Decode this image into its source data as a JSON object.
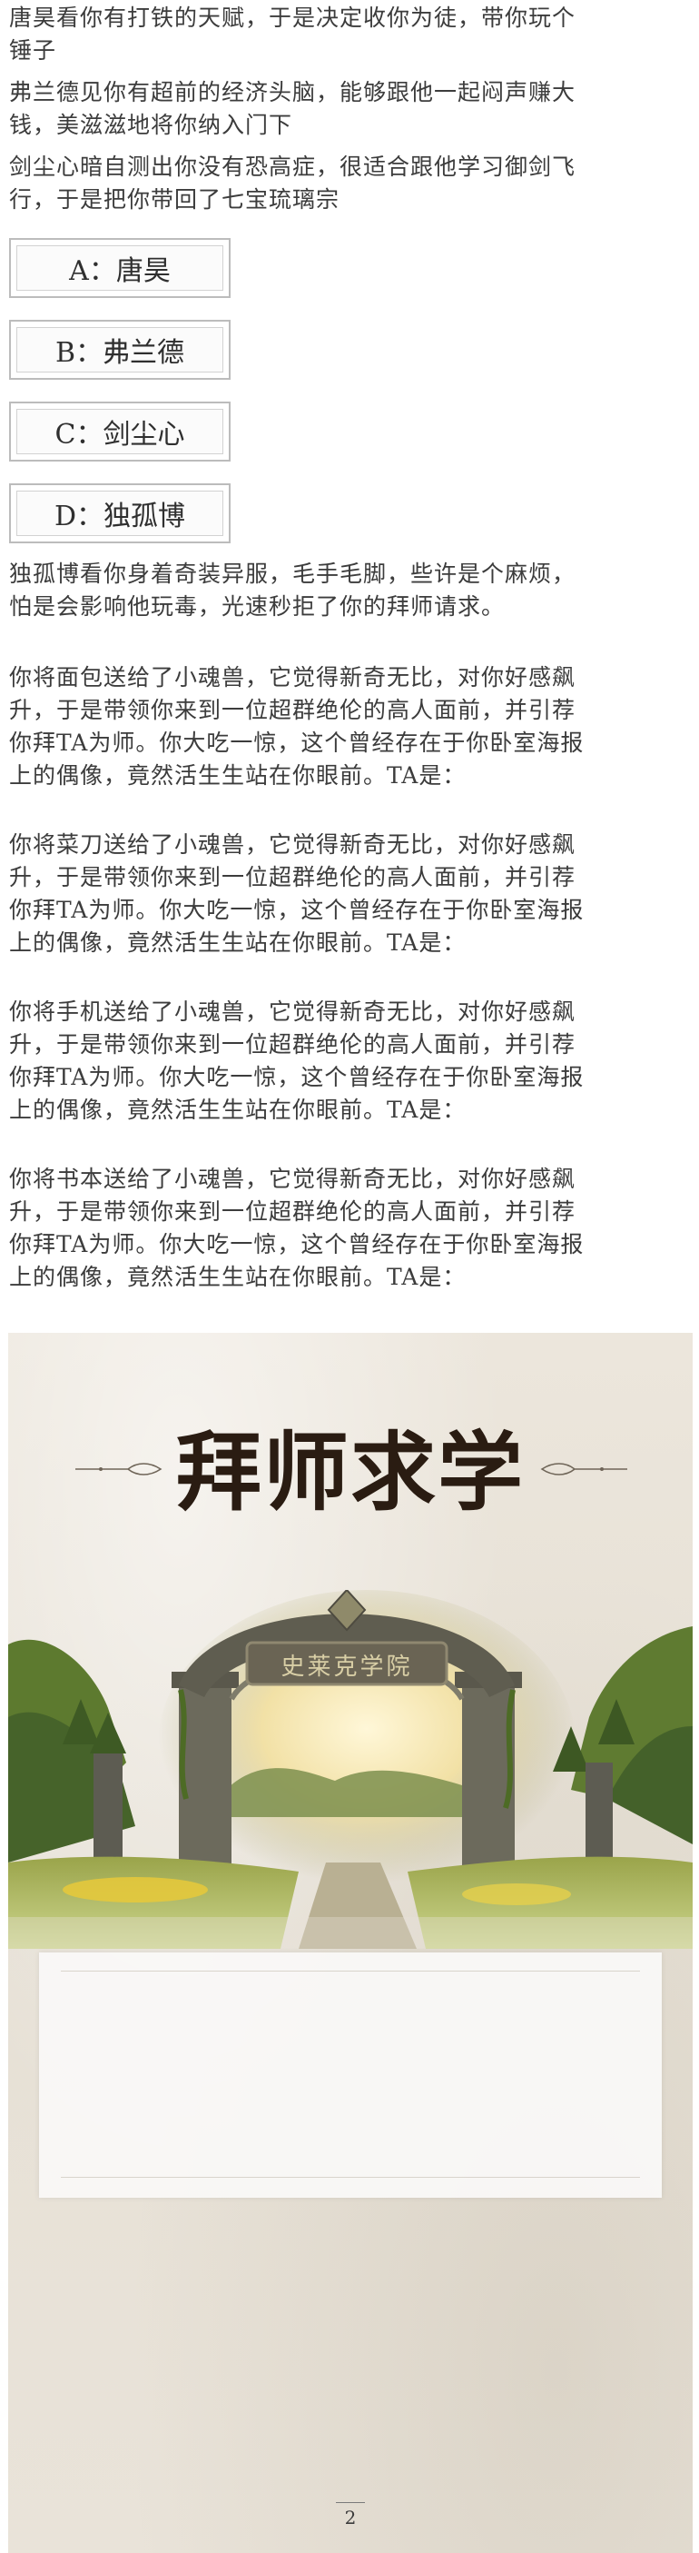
{
  "intro_paragraphs": [
    "唐昊看你有打铁的天赋，于是决定收你为徒，带你玩个锤子",
    "弗兰德见你有超前的经济头脑，能够跟他一起闷声赚大钱，美滋滋地将你纳入门下",
    "剑尘心暗自测出你没有恐高症，很适合跟他学习御剑飞行，于是把你带回了七宝琉璃宗"
  ],
  "options": [
    "A：唐昊",
    "B：弗兰德",
    "C：剑尘心",
    "D：独孤博"
  ],
  "result_paragraphs": [
    "独孤博看你身着奇装异服，毛手毛脚，些许是个麻烦，怕是会影响他玩毒，光速秒拒了你的拜师请求。",
    "你将面包送给了小魂兽，它觉得新奇无比，对你好感飙升，于是带领你来到一位超群绝伦的高人面前，并引荐你拜TA为师。你大吃一惊，这个曾经存在于你卧室海报上的偶像，竟然活生生站在你眼前。TA是：",
    "你将菜刀送给了小魂兽，它觉得新奇无比，对你好感飙升，于是带领你来到一位超群绝伦的高人面前，并引荐你拜TA为师。你大吃一惊，这个曾经存在于你卧室海报上的偶像，竟然活生生站在你眼前。TA是：",
    "你将手机送给了小魂兽，它觉得新奇无比，对你好感飙升，于是带领你来到一位超群绝伦的高人面前，并引荐你拜TA为师。你大吃一惊，这个曾经存在于你卧室海报上的偶像，竟然活生生站在你眼前。TA是：",
    "你将书本送给了小魂兽，它觉得新奇无比，对你好感飙升，于是带领你来到一位超群绝伦的高人面前，并引荐你拜TA为师。你大吃一惊，这个曾经存在于你卧室海报上的偶像，竟然活生生站在你眼前。TA是："
  ],
  "poster": {
    "title": "拜师求学",
    "gate_plaque": "史莱克学院",
    "page_number": "2"
  },
  "colors": {
    "paper": "#e9e3d9",
    "title_ink": "#2a1c12",
    "foliage": "#4f6a2e",
    "stone": "#6c6a5c"
  }
}
